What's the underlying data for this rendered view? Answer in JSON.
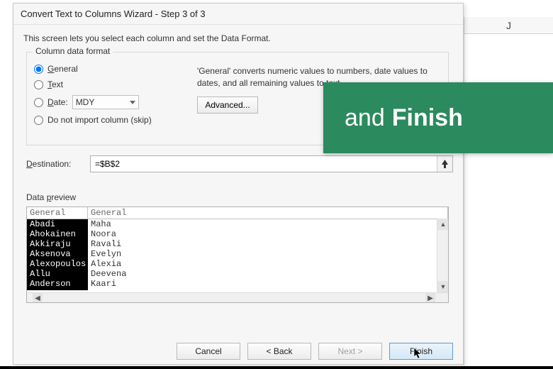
{
  "spreadsheet": {
    "visible_column_header": "J"
  },
  "dialog": {
    "title": "Convert Text to Columns Wizard - Step 3 of 3",
    "instruction": "This screen lets you select each column and set the Data Format.",
    "group_label": "Column data format",
    "radios": {
      "general": "General",
      "text": "Text",
      "date": "Date:",
      "skip": "Do not import column (skip)"
    },
    "date_format": "MDY",
    "description": "'General' converts numeric values to numbers, date values to dates, and all remaining values to text.",
    "advanced_label": "Advanced...",
    "destination_label": "Destination:",
    "destination_value": "=$B$2",
    "preview_label": "Data preview",
    "preview": {
      "headers": [
        "General",
        "General"
      ],
      "col1": [
        "Abadi",
        "Ahokainen",
        "Akkiraju",
        "Aksenova",
        "Alexopoulos",
        "Allu",
        "Anderson"
      ],
      "col2": [
        "Maha",
        "Noora",
        "Ravali",
        "Evelyn",
        "Alexia",
        "Deevena",
        "Kaari"
      ]
    },
    "buttons": {
      "cancel": "Cancel",
      "back": "< Back",
      "next": "Next >",
      "finish": "Finish"
    }
  },
  "overlay": {
    "text_and": "and",
    "text_finish": "Finish"
  }
}
